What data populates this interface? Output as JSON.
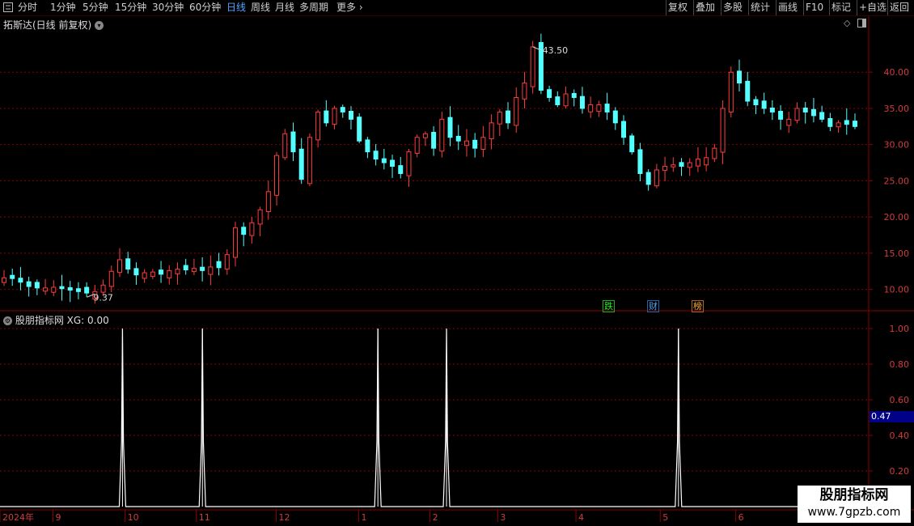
{
  "toolbar": {
    "left_items": [
      "分时",
      "1分钟",
      "5分钟",
      "15分钟",
      "30分钟",
      "60分钟",
      "日线",
      "周线",
      "月线",
      "多周期",
      "更多"
    ],
    "selected": "日线",
    "right_items": [
      "复权",
      "叠加",
      "多股",
      "统计",
      "画线",
      "F10",
      "标记",
      "+自选",
      "返回"
    ]
  },
  "main_chart": {
    "title": "拓斯达(日线 前复权)",
    "high_label": "43.50",
    "low_label": "9.37",
    "event_marks": [
      "跌",
      "财",
      "榜"
    ]
  },
  "indicator": {
    "title": "股朋指标网 XG: 0.00",
    "current_value": "0.47"
  },
  "watermark": {
    "line1": "股朋指标网",
    "line2": "www.7gpzb.com"
  },
  "colors": {
    "up": "#ff3c3c",
    "down": "#54ffff",
    "grid": "#8b0000",
    "axis_text": "#d23c3c"
  },
  "chart_data": [
    {
      "type": "candlestick",
      "title": "拓斯达(日线 前复权)",
      "ylim": [
        7.5,
        45.5
      ],
      "yticks": [
        10,
        15,
        20,
        25,
        30,
        35,
        40
      ],
      "ytick_labels": [
        "10.00",
        "15.00",
        "20.00",
        "25.00",
        "30.00",
        "35.00",
        "40.00"
      ],
      "annotations": [
        {
          "text": "43.50",
          "value": 43.5
        },
        {
          "text": "9.37",
          "value": 9.37
        }
      ],
      "close_path": [
        11.6,
        11.5,
        11.0,
        10.4,
        10.2,
        10.2,
        10.3,
        10.1,
        9.9,
        9.7,
        9.5,
        9.7,
        10.6,
        12.5,
        14.1,
        12.8,
        12.0,
        12.3,
        12.4,
        12.1,
        12.6,
        12.8,
        12.7,
        12.9,
        12.6,
        13.1,
        13.0,
        14.8,
        18.5,
        17.6,
        19.2,
        21.0,
        23.5,
        28.5,
        31.5,
        29.0,
        25.2,
        31.0,
        34.5,
        33.0,
        35.0,
        34.5,
        33.5,
        30.5,
        29.0,
        28.0,
        27.5,
        27.0,
        26.0,
        29.0,
        31.0,
        31.5,
        29.5,
        33.5,
        31.0,
        30.5,
        30.5,
        29.5,
        31.0,
        33.0,
        34.5,
        33.0,
        36.5,
        38.5,
        43.5,
        37.5,
        36.5,
        35.5,
        37.0,
        36.5,
        35.0,
        35.5,
        35.5,
        34.5,
        33.0,
        31.0,
        29.0,
        26.0,
        24.5,
        26.5,
        27.0,
        27.2,
        27.0,
        27.5,
        28.0,
        28.2,
        29.5,
        35.0,
        40.0,
        38.5,
        36.0,
        35.5,
        35.0,
        34.5,
        33.5,
        33.5,
        35.0,
        34.5,
        34.0,
        33.5,
        32.5,
        33.0,
        32.8,
        32.5
      ]
    },
    {
      "type": "line",
      "series": [
        {
          "name": "XG",
          "spike_x": [
            0.141,
            0.233,
            0.435,
            0.514,
            0.781
          ],
          "values_high": 1.0,
          "values_low": 0.0
        }
      ],
      "ylim": [
        0,
        1.1
      ],
      "yticks": [
        0.2,
        0.4,
        0.6,
        0.8,
        1.0
      ],
      "ytick_labels": [
        "0.20",
        "0.40",
        "0.60",
        "0.80",
        "1.00"
      ],
      "xtick_labels": [
        "2024年",
        "9",
        "10",
        "11",
        "12",
        "1",
        "2",
        "3",
        "4",
        "5",
        "6"
      ],
      "xtick_pos": [
        0.0,
        0.061,
        0.144,
        0.226,
        0.318,
        0.413,
        0.495,
        0.573,
        0.663,
        0.76,
        0.847
      ]
    }
  ]
}
